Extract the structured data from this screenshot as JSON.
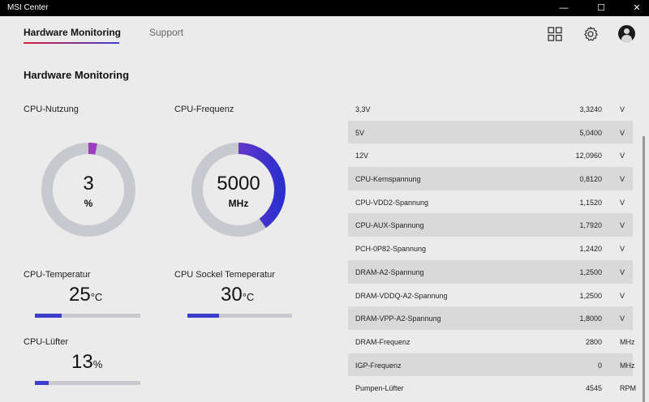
{
  "window": {
    "title": "MSI Center",
    "minimize": "—",
    "maximize": "☐",
    "close": "✕"
  },
  "tabs": [
    {
      "label": "Hardware Monitoring"
    },
    {
      "label": "Support"
    }
  ],
  "page_title": "Hardware Monitoring",
  "cpu_usage": {
    "label": "CPU-Nutzung",
    "value": "3",
    "unit": "%",
    "fraction": 0.03
  },
  "cpu_freq": {
    "label": "CPU-Frequenz",
    "value": "5000",
    "unit": "MHz",
    "fraction": 0.4
  },
  "cpu_temp": {
    "label": "CPU-Temperatur",
    "value": "25",
    "unit": "°C",
    "fraction": 0.25
  },
  "socket_temp": {
    "label": "CPU Sockel Temeperatur",
    "value": "30",
    "unit": "°C",
    "fraction": 0.3
  },
  "cpu_fan": {
    "label": "CPU-Lüfter",
    "value": "13",
    "unit": "%",
    "fraction": 0.13
  },
  "colors": {
    "accent": "#3d3fcc",
    "gauge_track": "#c7c9cf",
    "gauge_start": "#9b3dbd",
    "gauge_end": "#2d2fcf"
  },
  "sensors": [
    {
      "name": "3,3V",
      "value": "3,3240",
      "unit": "V"
    },
    {
      "name": "5V",
      "value": "5,0400",
      "unit": "V"
    },
    {
      "name": "12V",
      "value": "12,0960",
      "unit": "V"
    },
    {
      "name": "CPU-Kernspannung",
      "value": "0,8120",
      "unit": "V"
    },
    {
      "name": "CPU-VDD2-Spannung",
      "value": "1,1520",
      "unit": "V"
    },
    {
      "name": "CPU-AUX-Spannung",
      "value": "1,7920",
      "unit": "V"
    },
    {
      "name": "PCH-0P82-Spannung",
      "value": "1,2420",
      "unit": "V"
    },
    {
      "name": "DRAM-A2-Spannung",
      "value": "1,2500",
      "unit": "V"
    },
    {
      "name": "DRAM-VDDQ-A2-Spannung",
      "value": "1,2500",
      "unit": "V"
    },
    {
      "name": "DRAM-VPP-A2-Spannung",
      "value": "1,8000",
      "unit": "V"
    },
    {
      "name": "DRAM-Frequenz",
      "value": "2800",
      "unit": "MHz"
    },
    {
      "name": "IGP-Frequenz",
      "value": "0",
      "unit": "MHz"
    },
    {
      "name": "Pumpen-Lüfter",
      "value": "4545",
      "unit": "RPM"
    }
  ]
}
